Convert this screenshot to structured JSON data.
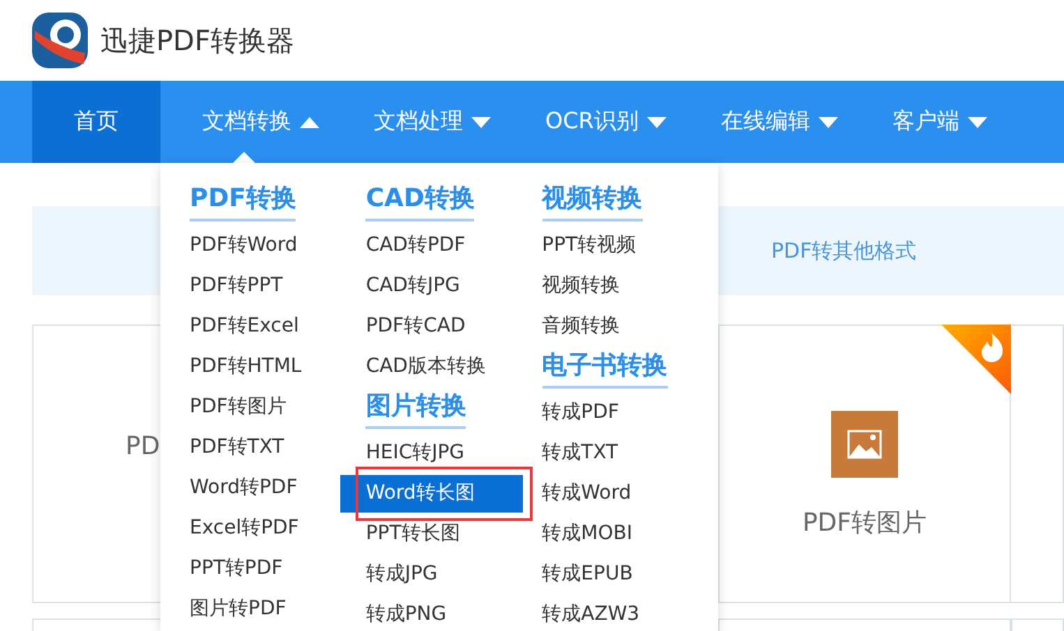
{
  "header": {
    "title": "迅捷PDF转换器"
  },
  "nav": {
    "tabs": [
      {
        "label": "首页",
        "kind": "link",
        "selected": true
      },
      {
        "label": "文档转换",
        "kind": "menu",
        "selected": false,
        "expanded": true
      },
      {
        "label": "文档处理",
        "kind": "menu",
        "selected": false,
        "expanded": false
      },
      {
        "label": "OCR识别",
        "kind": "menu",
        "selected": false,
        "expanded": false
      },
      {
        "label": "在线编辑",
        "kind": "menu",
        "selected": false,
        "expanded": false
      },
      {
        "label": "客户端",
        "kind": "menu",
        "selected": false,
        "expanded": false
      }
    ]
  },
  "dropdown": {
    "columns": [
      {
        "groups": [
          {
            "heading": "PDF转换",
            "items": [
              {
                "label": "PDF转Word",
                "selected": false,
                "boxed": false
              },
              {
                "label": "PDF转PPT",
                "selected": false,
                "boxed": false
              },
              {
                "label": "PDF转Excel",
                "selected": false,
                "boxed": false
              },
              {
                "label": "PDF转HTML",
                "selected": false,
                "boxed": false
              },
              {
                "label": "PDF转图片",
                "selected": false,
                "boxed": false
              },
              {
                "label": "PDF转TXT",
                "selected": false,
                "boxed": false
              },
              {
                "label": "Word转PDF",
                "selected": false,
                "boxed": false
              },
              {
                "label": "Excel转PDF",
                "selected": false,
                "boxed": false
              },
              {
                "label": "PPT转PDF",
                "selected": false,
                "boxed": false
              },
              {
                "label": "图片转PDF",
                "selected": false,
                "boxed": false
              }
            ]
          }
        ]
      },
      {
        "groups": [
          {
            "heading": "CAD转换",
            "items": [
              {
                "label": "CAD转PDF",
                "selected": false,
                "boxed": false
              },
              {
                "label": "CAD转JPG",
                "selected": false,
                "boxed": false
              },
              {
                "label": "PDF转CAD",
                "selected": false,
                "boxed": false
              },
              {
                "label": "CAD版本转换",
                "selected": false,
                "boxed": false
              }
            ]
          },
          {
            "heading": "图片转换",
            "items": [
              {
                "label": "HEIC转JPG",
                "selected": false,
                "boxed": false
              },
              {
                "label": "Word转长图",
                "selected": true,
                "boxed": true
              },
              {
                "label": "PPT转长图",
                "selected": false,
                "boxed": false
              },
              {
                "label": "转成JPG",
                "selected": false,
                "boxed": false
              },
              {
                "label": "转成PNG",
                "selected": false,
                "boxed": false
              }
            ]
          }
        ]
      },
      {
        "groups": [
          {
            "heading": "视频转换",
            "items": [
              {
                "label": "PPT转视频",
                "selected": false,
                "boxed": false
              },
              {
                "label": "视频转换",
                "selected": false,
                "boxed": false
              },
              {
                "label": "音频转换",
                "selected": false,
                "boxed": false
              }
            ]
          },
          {
            "heading": "电子书转换",
            "items": [
              {
                "label": "转成PDF",
                "selected": false,
                "boxed": false
              },
              {
                "label": "转成TXT",
                "selected": false,
                "boxed": false
              },
              {
                "label": "转成Word",
                "selected": false,
                "boxed": false
              },
              {
                "label": "转成MOBI",
                "selected": false,
                "boxed": false
              },
              {
                "label": "转成EPUB",
                "selected": false,
                "boxed": false
              },
              {
                "label": "转成AZW3",
                "selected": false,
                "boxed": false
              }
            ]
          }
        ]
      }
    ]
  },
  "content": {
    "banner": {
      "label": "PDF转其他格式"
    },
    "cards": [
      {
        "label": "PD",
        "kind": "text"
      },
      {
        "label": "PDF转图片",
        "kind": "image",
        "hot": true
      }
    ]
  }
}
